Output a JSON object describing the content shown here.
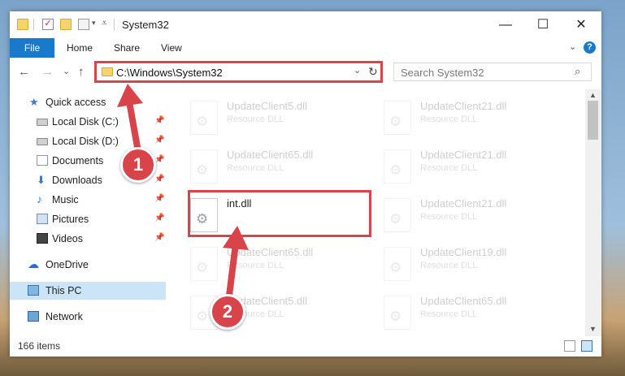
{
  "window": {
    "title": "System32",
    "controls": {
      "minimize": "—",
      "maximize": "☐",
      "close": "✕"
    }
  },
  "ribbon": {
    "tabs": [
      {
        "label": "File"
      },
      {
        "label": "Home"
      },
      {
        "label": "Share"
      },
      {
        "label": "View"
      }
    ],
    "help": "?"
  },
  "nav": {
    "back": "←",
    "forward": "→",
    "recent": "⌄",
    "up": "↑",
    "address": "C:\\Windows\\System32",
    "search_placeholder": "Search System32"
  },
  "sidebar": {
    "items": [
      {
        "label": "Quick access",
        "icon": "star-icon"
      },
      {
        "label": "Local Disk (C:)",
        "icon": "disk-icon"
      },
      {
        "label": "Local Disk (D:)",
        "icon": "disk-icon"
      },
      {
        "label": "Documents",
        "icon": "documents-icon"
      },
      {
        "label": "Downloads",
        "icon": "downloads-icon"
      },
      {
        "label": "Music",
        "icon": "music-icon"
      },
      {
        "label": "Pictures",
        "icon": "pictures-icon"
      },
      {
        "label": "Videos",
        "icon": "videos-icon"
      },
      {
        "label": "OneDrive",
        "icon": "onedrive-icon"
      },
      {
        "label": "This PC",
        "icon": "pc-icon",
        "selected": true
      },
      {
        "label": "Network",
        "icon": "network-icon"
      }
    ]
  },
  "files": [
    {
      "name": "UpdateClient5.dll",
      "type": "Resource DLL"
    },
    {
      "name": "UpdateClient21.dll",
      "type": "Resource DLL"
    },
    {
      "name": "UpdateClient65.dll",
      "type": "Resource DLL"
    },
    {
      "name": "UpdateClient21.dll",
      "type": "Resource DLL"
    },
    {
      "name": "int.dll",
      "type": "",
      "highlighted": true
    },
    {
      "name": "UpdateClient21.dll",
      "type": "Resource DLL"
    },
    {
      "name": "UpdateClient65.dll",
      "type": "Resource DLL"
    },
    {
      "name": "UpdateClient19.dll",
      "type": "Resource DLL"
    },
    {
      "name": "UpdateClient5.dll",
      "type": "Resource DLL"
    },
    {
      "name": "UpdateClient65.dll",
      "type": "Resource DLL"
    }
  ],
  "status": {
    "item_count": "166 items"
  },
  "annotations": {
    "step1": "1",
    "step2": "2",
    "color": "#d9434a"
  }
}
